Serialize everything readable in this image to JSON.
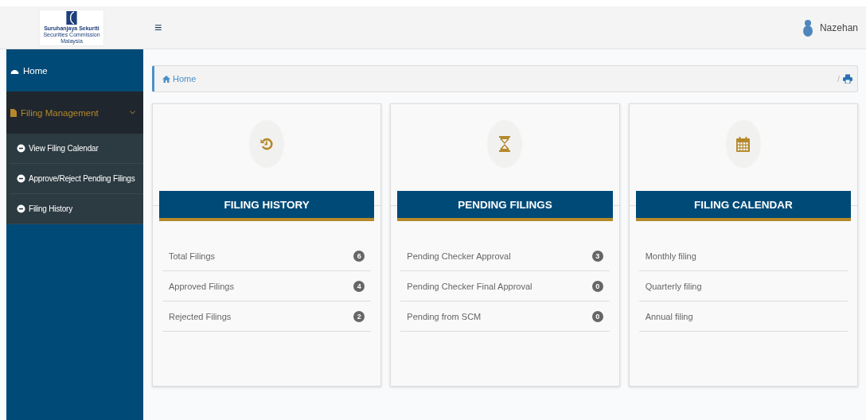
{
  "header": {
    "logo_lines": [
      "Suruhanjaya Sekuriti",
      "Securities Commission",
      "Malaysia"
    ],
    "menu_glyph": "≡",
    "user": "Nazehan"
  },
  "sidebar": {
    "items": [
      {
        "label": "Home",
        "expanded": false
      },
      {
        "label": "Filing Management",
        "expanded": true,
        "children": [
          {
            "label": "View Filing Calendar"
          },
          {
            "label": "Approve/Reject Pending Filings"
          },
          {
            "label": "Filing History"
          }
        ]
      }
    ]
  },
  "breadcrumb": {
    "items": [
      "Home"
    ],
    "separator": "/"
  },
  "cards": [
    {
      "kind": "history",
      "title": "FILING HISTORY",
      "rows": [
        {
          "label": "Total Filings",
          "count": "6"
        },
        {
          "label": "Approved Filings",
          "count": "4"
        },
        {
          "label": "Rejected Filings",
          "count": "2"
        }
      ]
    },
    {
      "kind": "pending",
      "title": "PENDING FILINGS",
      "rows": [
        {
          "label": "Pending Checker Approval",
          "count": "3"
        },
        {
          "label": "Pending Checker Final Approval",
          "count": "0"
        },
        {
          "label": "Pending from SCM",
          "count": "0"
        }
      ]
    },
    {
      "kind": "calendar",
      "title": "FILING CALENDAR",
      "rows": [
        {
          "label": "Monthly filing"
        },
        {
          "label": "Quarterly filing"
        },
        {
          "label": "Annual filing"
        }
      ]
    }
  ]
}
